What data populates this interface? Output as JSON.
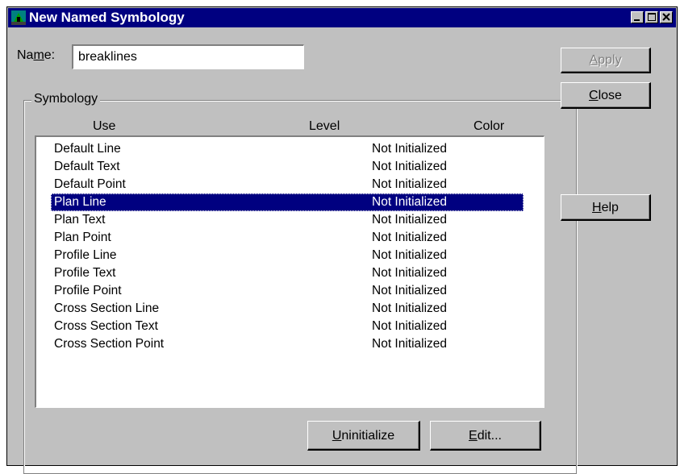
{
  "window": {
    "title": "New Named Symbology"
  },
  "name_field": {
    "label_pre": "Na",
    "label_acc": "m",
    "label_post": "e:",
    "value": "breaklines"
  },
  "group": {
    "label": "Symbology"
  },
  "columns": {
    "use": "Use",
    "level": "Level",
    "color": "Color"
  },
  "rows": [
    {
      "use": "Default Line",
      "level": "Not Initialized"
    },
    {
      "use": "Default Text",
      "level": "Not Initialized"
    },
    {
      "use": "Default Point",
      "level": "Not Initialized"
    },
    {
      "use": "Plan Line",
      "level": "Not Initialized",
      "selected": true
    },
    {
      "use": "Plan Text",
      "level": "Not Initialized"
    },
    {
      "use": "Plan Point",
      "level": "Not Initialized"
    },
    {
      "use": "Profile Line",
      "level": "Not Initialized"
    },
    {
      "use": "Profile Text",
      "level": "Not Initialized"
    },
    {
      "use": "Profile Point",
      "level": "Not Initialized"
    },
    {
      "use": "Cross Section Line",
      "level": "Not Initialized"
    },
    {
      "use": "Cross Section Text",
      "level": "Not Initialized"
    },
    {
      "use": "Cross Section Point",
      "level": "Not Initialized"
    }
  ],
  "buttons": {
    "apply": {
      "acc": "A",
      "rest": "pply",
      "enabled": false
    },
    "close": {
      "acc": "C",
      "rest": "lose"
    },
    "help": {
      "acc": "H",
      "rest": "elp"
    },
    "uninitialize": {
      "acc": "U",
      "rest": "ninitialize"
    },
    "edit": {
      "acc": "E",
      "rest": "dit..."
    }
  },
  "colors": {
    "titlebar": "#000080",
    "face": "#c0c0c0",
    "selection": "#000080"
  },
  "icons": {
    "app": "app-logo-icon",
    "minimize": "minimize-icon",
    "maximize": "maximize-icon",
    "close": "close-icon"
  }
}
